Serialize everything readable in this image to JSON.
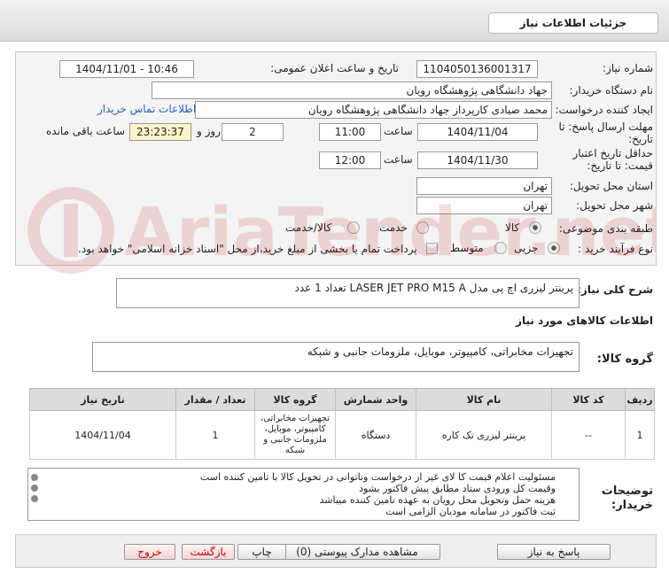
{
  "header": {
    "title": "جزئیات اطلاعات نیاز"
  },
  "fields": {
    "need_number_label": "شماره نیاز:",
    "need_number": "1104050136001317",
    "announce_label": "تاریخ و ساعت اعلان عمومی:",
    "announce_value": "1404/11/01 - 10:46",
    "buyer_label": "نام دستگاه خریدار:",
    "buyer_value": "جهاد دانشگاهی پژوهشگاه رویان",
    "requester_label": "ایجاد کننده درخواست:",
    "requester_value": "محمد صیادی کارپرداز جهاد دانشگاهی پژوهشگاه رویان",
    "contact_link": "اطلاعات تماس خریدار",
    "send_deadline_label": "مهلت ارسال پاسخ: تا تاریخ:",
    "send_deadline_date": "1404/11/04",
    "time_label": "ساعت",
    "send_deadline_time": "11:00",
    "days_value": "2",
    "days_label": "روز و",
    "time_remaining": "23:23:37",
    "remaining_label": "ساعت باقی مانده",
    "price_validity_label": "حداقل تاریخ اعتبار قیمت: تا تاریخ:",
    "price_validity_date": "1404/11/30",
    "price_validity_time": "12:00",
    "province_label": "استان محل تحویل:",
    "province_value": "تهران",
    "city_label": "شهر محل تحویل:",
    "city_value": "تهران",
    "category_label": "طبقه بندی موضوعی:",
    "category_options": [
      "کالا",
      "خدمت",
      "کالا/خدمت"
    ],
    "purchase_type_label": "نوع فرآیند خرید :",
    "purchase_type_options": [
      "جزیی",
      "متوسط"
    ],
    "payment_note": "پرداخت تمام یا بخشی از مبلغ خرید،از محل \"اسناد خزانه اسلامی\" خواهد بود."
  },
  "summary": {
    "label": "شرح کلی نیاز:",
    "value": "پرینتر لیزری اچ پی مدل LASER JET PRO M15 A تعداد 1 عدد"
  },
  "goods_info": {
    "title": "اطلاعات کالاهای مورد نیاز",
    "group_label": "گروه کالا:",
    "group_value": "تجهیزات مخابراتی، کامپیوتر، موبایل، ملزومات جانبی و شبکه"
  },
  "table": {
    "headers": [
      "ردیف",
      "کد کالا",
      "نام کالا",
      "واحد شمارش",
      "گروه کالا",
      "تعداد / مقدار",
      "تاریخ نیاز"
    ],
    "rows": [
      [
        "1",
        "--",
        "پرینتر لیزری تک کاره",
        "دستگاه",
        "تجهیزات مخابراتی، کامپیوتر، موبایل، ملزومات جانبی و شبکه",
        "1",
        "1404/11/04"
      ]
    ]
  },
  "buyer_notes": {
    "label": "توضیحات خریدار:",
    "lines": [
      "مسئولیت اعلام قیمت کا لای  غیر از درخواست وناتوانی در تحویل کالا با تامین کننده است",
      "وقیمت کل ورودی ستاد مطابق پیش فاکتور بشود",
      "هزینه حمل وتحویل محل رویان به عهده تامین کننده میباشد",
      "ثبت فاکتور در سامانه مودیان الزامی است"
    ]
  },
  "buttons": {
    "reply": "پاسخ به نیاز",
    "attachments": "مشاهده مدارک پیوستی (0)",
    "print": "چاپ",
    "back": "بازگشت",
    "exit": "خروج"
  },
  "watermark": "AriaTender.net"
}
